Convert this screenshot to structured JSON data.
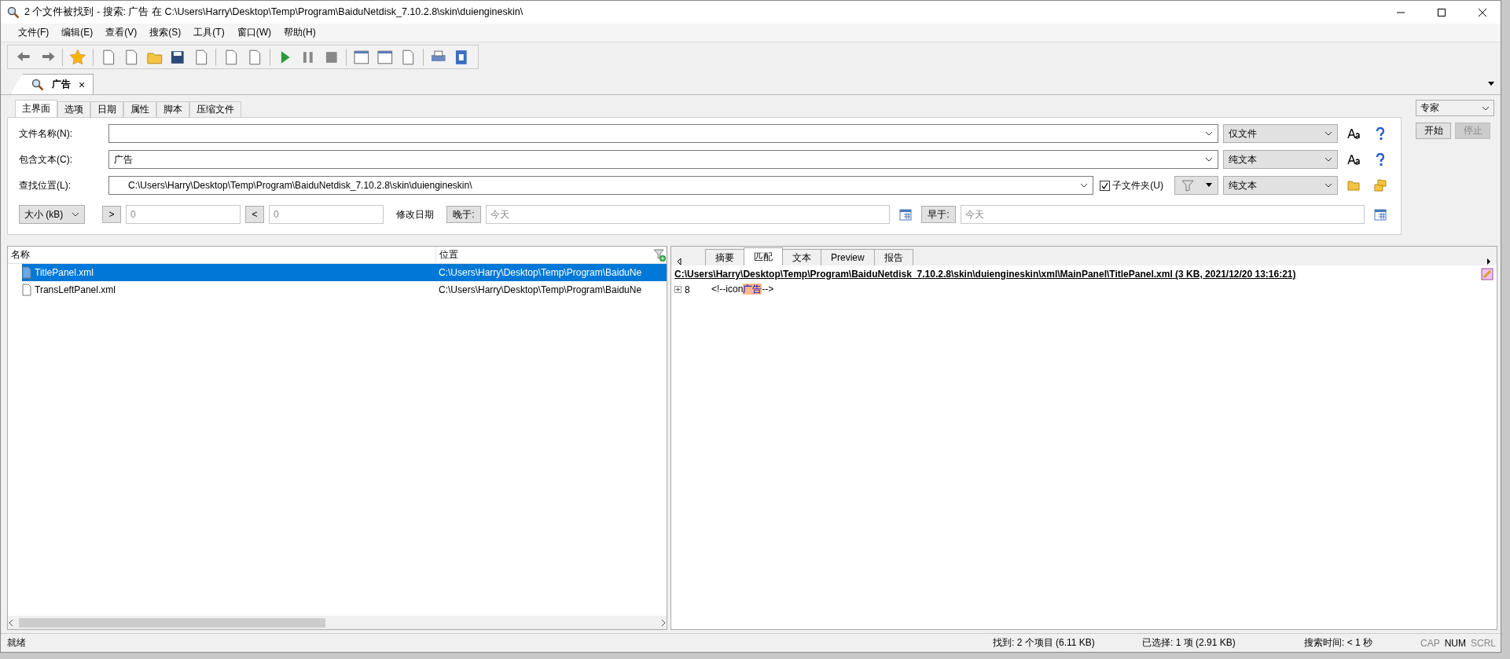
{
  "window": {
    "title": "2 个文件被找到 - 搜索: 广告 在 C:\\Users\\Harry\\Desktop\\Temp\\Program\\BaiduNetdisk_7.10.2.8\\skin\\duiengineskin\\"
  },
  "menu": [
    "文件(F)",
    "编辑(E)",
    "查看(V)",
    "搜索(S)",
    "工具(T)",
    "窗口(W)",
    "帮助(H)"
  ],
  "doc_tabs": [
    {
      "label": "广告",
      "selected": true,
      "close": "×"
    }
  ],
  "search_tabs": [
    {
      "label": "主界面",
      "selected": true
    },
    {
      "label": "选项",
      "selected": false
    },
    {
      "label": "日期",
      "selected": false
    },
    {
      "label": "属性",
      "selected": false
    },
    {
      "label": "脚本",
      "selected": false
    },
    {
      "label": "压缩文件",
      "selected": false
    }
  ],
  "form": {
    "filename": {
      "label": "文件名称(N):",
      "type": "仅文件"
    },
    "content": {
      "label": "包含文本(C):",
      "value": "广告",
      "type": "纯文本"
    },
    "location": {
      "label": "查找位置(L):",
      "value": "C:\\Users\\Harry\\Desktop\\Temp\\Program\\BaiduNetdisk_7.10.2.8\\skin\\duiengineskin\\",
      "subfolders_label": "子文件夹(U)",
      "subfolders": true,
      "type": "纯文本"
    },
    "size": {
      "unit": "大小 (kB)",
      "gt": ">",
      "gt_value": "0",
      "lt": "<",
      "lt_value": "0"
    },
    "date": {
      "label": "修改日期",
      "after": "晚于:",
      "after_value": "今天",
      "before": "早于:",
      "before_value": "今天"
    }
  },
  "mode": "专家",
  "actions": [
    {
      "label": "开始",
      "disabled": false
    },
    {
      "label": "停止",
      "disabled": true
    }
  ],
  "results": {
    "columns": [
      "名称",
      "位置"
    ],
    "rows": [
      {
        "name": "TitlePanel.xml",
        "location": "C:\\Users\\Harry\\Desktop\\Temp\\Program\\BaiduNe",
        "selected": true
      },
      {
        "name": "TransLeftPanel.xml",
        "location": "C:\\Users\\Harry\\Desktop\\Temp\\Program\\BaiduNe",
        "selected": false
      }
    ]
  },
  "preview": {
    "tabs": [
      {
        "label": "摘要",
        "selected": false
      },
      {
        "label": "匹配",
        "selected": true
      },
      {
        "label": "文本",
        "selected": false
      },
      {
        "label": "Preview",
        "selected": false
      },
      {
        "label": "报告",
        "selected": false
      }
    ],
    "file_header": "C:\\Users\\Harry\\Desktop\\Temp\\Program\\BaiduNetdisk_7.10.2.8\\skin\\duiengineskin\\xml\\MainPanel\\TitlePanel.xml   (3 KB,  2021/12/20 13:16:21)",
    "matches": [
      {
        "line": "8",
        "before": "<!--icon",
        "match": "广告",
        "after": "-->"
      }
    ]
  },
  "status_bar": {
    "state": "就绪",
    "found": "找到: 2 个项目 (6.11 KB)",
    "selected": "已选择: 1 项 (2.91 KB)",
    "time": "搜索时间: < 1 秒",
    "keys": [
      {
        "label": "CAP",
        "on": false
      },
      {
        "label": "NUM",
        "on": true
      },
      {
        "label": "SCRL",
        "on": false
      }
    ]
  }
}
